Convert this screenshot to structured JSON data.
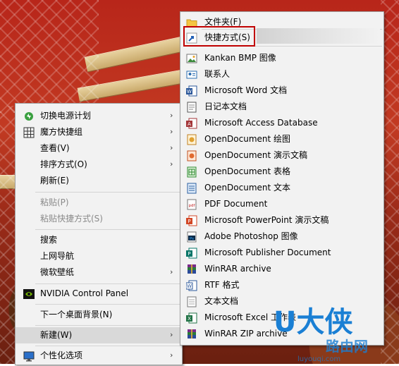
{
  "left_menu": {
    "items": [
      {
        "label": "切换电源计划",
        "icon": "power-plan-icon",
        "submenu": true,
        "enabled": true
      },
      {
        "label": "魔方快捷组",
        "icon": "grid-icon",
        "submenu": true,
        "enabled": true
      },
      {
        "label": "查看(V)",
        "icon": "",
        "submenu": true,
        "enabled": true
      },
      {
        "label": "排序方式(O)",
        "icon": "",
        "submenu": true,
        "enabled": true
      },
      {
        "label": "刷新(E)",
        "icon": "",
        "submenu": false,
        "enabled": true
      },
      {
        "label": "粘贴(P)",
        "icon": "",
        "submenu": false,
        "enabled": false
      },
      {
        "label": "粘贴快捷方式(S)",
        "icon": "",
        "submenu": false,
        "enabled": false
      },
      {
        "label": "搜索",
        "icon": "",
        "submenu": false,
        "enabled": true
      },
      {
        "label": "上网导航",
        "icon": "",
        "submenu": false,
        "enabled": true
      },
      {
        "label": "微软壁纸",
        "icon": "",
        "submenu": true,
        "enabled": true
      },
      {
        "label": "NVIDIA Control Panel",
        "icon": "nvidia-icon",
        "submenu": false,
        "enabled": true
      },
      {
        "label": "下一个桌面背景(N)",
        "icon": "",
        "submenu": false,
        "enabled": true
      },
      {
        "label": "新建(W)",
        "icon": "",
        "submenu": true,
        "enabled": true
      },
      {
        "label": "个性化选项",
        "icon": "monitor-icon",
        "submenu": true,
        "enabled": true
      }
    ]
  },
  "right_menu": {
    "items": [
      {
        "label": "文件夹(F)",
        "icon": "folder-icon"
      },
      {
        "label": "快捷方式(S)",
        "icon": "shortcut-icon"
      },
      {
        "label": "Kankan BMP 图像",
        "icon": "bmp-image-icon"
      },
      {
        "label": "联系人",
        "icon": "contact-icon"
      },
      {
        "label": "Microsoft Word 文档",
        "icon": "word-icon"
      },
      {
        "label": "日记本文档",
        "icon": "journal-icon"
      },
      {
        "label": "Microsoft Access Database",
        "icon": "access-icon"
      },
      {
        "label": "OpenDocument 绘图",
        "icon": "odg-icon"
      },
      {
        "label": "OpenDocument 演示文稿",
        "icon": "odp-icon"
      },
      {
        "label": "OpenDocument 表格",
        "icon": "ods-icon"
      },
      {
        "label": "OpenDocument 文本",
        "icon": "odt-icon"
      },
      {
        "label": "PDF Document",
        "icon": "pdf-icon"
      },
      {
        "label": "Microsoft PowerPoint 演示文稿",
        "icon": "powerpoint-icon"
      },
      {
        "label": "Adobe Photoshop 图像",
        "icon": "photoshop-icon"
      },
      {
        "label": "Microsoft Publisher Document",
        "icon": "publisher-icon"
      },
      {
        "label": "WinRAR archive",
        "icon": "winrar-icon"
      },
      {
        "label": "RTF 格式",
        "icon": "rtf-icon"
      },
      {
        "label": "文本文档",
        "icon": "text-doc-icon"
      },
      {
        "label": "Microsoft Excel 工作表",
        "icon": "excel-icon"
      },
      {
        "label": "WinRAR ZIP archive",
        "icon": "winrar-zip-icon"
      }
    ]
  },
  "watermark": {
    "brand": "U大侠",
    "sub": "路由网",
    "url": "luyouqi.com"
  },
  "colors": {
    "highlight_border": "#c00000",
    "menu_bg": "#f2f2f2",
    "hover_bg": "#d9d9d9",
    "watermark_blue": "#1a7fd4"
  }
}
